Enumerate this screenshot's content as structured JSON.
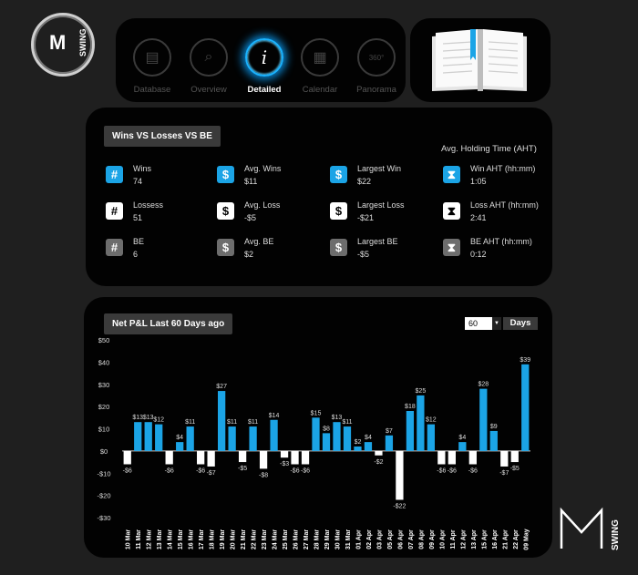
{
  "logo": {
    "mark": "M",
    "sub": "SWING"
  },
  "nav": [
    {
      "label": "Database",
      "icon": "database-icon",
      "glyph": "▤",
      "active": false
    },
    {
      "label": "Overview",
      "icon": "overview-icon",
      "glyph": "⌕",
      "active": false
    },
    {
      "label": "Detailed",
      "icon": "info-icon",
      "glyph": "i",
      "active": true
    },
    {
      "label": "Calendar",
      "icon": "calendar-icon",
      "glyph": "▦",
      "active": false
    },
    {
      "label": "Panorama",
      "icon": "panorama-icon",
      "glyph": "360°",
      "active": false
    }
  ],
  "stats": {
    "title": "Wins VS Losses VS BE",
    "aht_title": "Avg. Holding Time (AHT)",
    "items": [
      {
        "label": "Wins",
        "value": "74",
        "icon": "hash-icon",
        "glyph": "#",
        "color": "blue"
      },
      {
        "label": "Avg. Wins",
        "value": "$11",
        "icon": "dollar-icon",
        "glyph": "$",
        "color": "blue"
      },
      {
        "label": "Largest Win",
        "value": "$22",
        "icon": "dollar-icon",
        "glyph": "$",
        "color": "blue"
      },
      {
        "label": "Win AHT (hh:mm)",
        "value": "1:05",
        "icon": "hourglass-icon",
        "glyph": "⧗",
        "color": "blue"
      },
      {
        "label": "Lossess",
        "value": "51",
        "icon": "hash-icon",
        "glyph": "#",
        "color": "white"
      },
      {
        "label": "Avg. Loss",
        "value": "-$5",
        "icon": "dollar-icon",
        "glyph": "$",
        "color": "white"
      },
      {
        "label": "Largest Loss",
        "value": "-$21",
        "icon": "dollar-icon",
        "glyph": "$",
        "color": "white"
      },
      {
        "label": "Loss AHT (hh:mm)",
        "value": "2:41",
        "icon": "hourglass-icon",
        "glyph": "⧗",
        "color": "white"
      },
      {
        "label": "BE",
        "value": "6",
        "icon": "hash-icon",
        "glyph": "#",
        "color": "grey"
      },
      {
        "label": "Avg. BE",
        "value": "$2",
        "icon": "dollar-icon",
        "glyph": "$",
        "color": "grey"
      },
      {
        "label": "Largest BE",
        "value": "-$5",
        "icon": "dollar-icon",
        "glyph": "$",
        "color": "grey"
      },
      {
        "label": "BE AHT (hh:mm)",
        "value": "0:12",
        "icon": "hourglass-icon",
        "glyph": "⧗",
        "color": "grey"
      }
    ]
  },
  "chart_header": {
    "title": "Net P&L Last 60 Days ago",
    "days_value": "60",
    "days_label": "Days"
  },
  "brand": {
    "mark": "M",
    "sub": "SWING"
  },
  "colors": {
    "accent": "#1ba4e6",
    "positive": "#1ba4e6",
    "negative": "#ffffff",
    "background": "#1f1f1f",
    "panel": "#020202"
  },
  "chart_data": {
    "type": "bar",
    "title": "Net P&L Last 60 Days ago",
    "ylim": [
      -30,
      50
    ],
    "yticks": [
      "$50",
      "$40",
      "$30",
      "$20",
      "$10",
      "$0",
      "-$10",
      "-$20",
      "-$30"
    ],
    "grid": false,
    "bars": [
      {
        "x": "10 Mar",
        "pos": null,
        "neg": -6
      },
      {
        "x": "11 Mar",
        "pos": 13,
        "neg": null
      },
      {
        "x": "12 Mar",
        "pos": 13,
        "neg": null
      },
      {
        "x": "13 Mar",
        "pos": 12,
        "neg": null
      },
      {
        "x": "14 Mar",
        "pos": null,
        "neg": -6
      },
      {
        "x": "15 Mar",
        "pos": 4,
        "neg": null
      },
      {
        "x": "16 Mar",
        "pos": 11,
        "neg": null
      },
      {
        "x": "17 Mar",
        "pos": null,
        "neg": -6
      },
      {
        "x": "18 Mar",
        "pos": null,
        "neg": -7
      },
      {
        "x": "19 Mar",
        "pos": 27,
        "neg": null
      },
      {
        "x": "20 Mar",
        "pos": 11,
        "neg": null
      },
      {
        "x": "21 Mar",
        "pos": null,
        "neg": -5
      },
      {
        "x": "22 Mar",
        "pos": 11,
        "neg": null
      },
      {
        "x": "23 Mar",
        "pos": null,
        "neg": -8
      },
      {
        "x": "24 Mar",
        "pos": 14,
        "neg": null
      },
      {
        "x": "25 Mar",
        "pos": null,
        "neg": -3
      },
      {
        "x": "26 Mar",
        "pos": null,
        "neg": -6
      },
      {
        "x": "27 Mar",
        "pos": null,
        "neg": -6
      },
      {
        "x": "28 Mar",
        "pos": 15,
        "neg": null
      },
      {
        "x": "29 Mar",
        "pos": 8,
        "neg": null
      },
      {
        "x": "30 Mar",
        "pos": 13,
        "neg": null
      },
      {
        "x": "31 Mar",
        "pos": 11,
        "neg": null
      },
      {
        "x": "01 Apr",
        "pos": 2,
        "neg": null
      },
      {
        "x": "02 Apr",
        "pos": 4,
        "neg": null
      },
      {
        "x": "03 Apr",
        "pos": null,
        "neg": -2
      },
      {
        "x": "05 Apr",
        "pos": 7,
        "neg": null
      },
      {
        "x": "06 Apr",
        "pos": null,
        "neg": -22
      },
      {
        "x": "07 Apr",
        "pos": 18,
        "neg": null
      },
      {
        "x": "08 Apr",
        "pos": 25,
        "neg": null
      },
      {
        "x": "09 Apr",
        "pos": 12,
        "neg": null
      },
      {
        "x": "10 Apr",
        "pos": null,
        "neg": -6
      },
      {
        "x": "11 Apr",
        "pos": null,
        "neg": -6
      },
      {
        "x": "12 Apr",
        "pos": 4,
        "neg": null
      },
      {
        "x": "13 Apr",
        "pos": null,
        "neg": -6
      },
      {
        "x": "15 Apr",
        "pos": 28,
        "neg": null
      },
      {
        "x": "16 Apr",
        "pos": 9,
        "neg": null
      },
      {
        "x": "21 Apr",
        "pos": null,
        "neg": -7
      },
      {
        "x": "22 Apr",
        "pos": null,
        "neg": -5
      },
      {
        "x": "09 May",
        "pos": 39,
        "neg": null
      }
    ]
  }
}
